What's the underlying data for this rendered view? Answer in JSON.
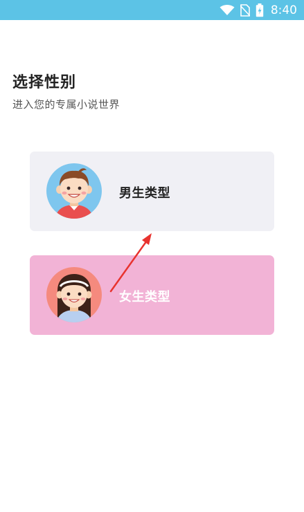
{
  "status_bar": {
    "time": "8:40",
    "icons": [
      "wifi-icon",
      "no-sim-icon",
      "battery-charging-icon"
    ]
  },
  "header": {
    "title": "选择性别",
    "subtitle": "进入您的专属小说世界"
  },
  "options": {
    "male": {
      "label": "男生类型",
      "icon": "boy-avatar-icon"
    },
    "female": {
      "label": "女生类型",
      "icon": "girl-avatar-icon"
    }
  },
  "colors": {
    "status_bar": "#5cc3e6",
    "male_card": "#f0f0f5",
    "female_card": "#f2b3d6",
    "arrow": "#e8332f"
  }
}
